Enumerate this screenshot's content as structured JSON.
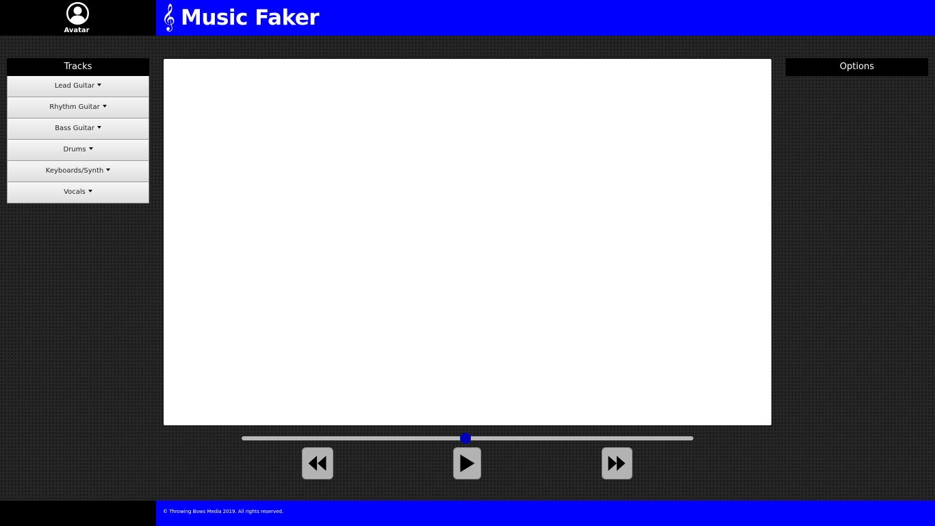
{
  "header": {
    "avatar_label": "Avatar",
    "avatar_icon": "user-circle-icon",
    "clef_icon": "treble-clef-icon",
    "clef_glyph": "𝄞",
    "title": "Music Faker"
  },
  "tracks": {
    "heading": "Tracks",
    "items": [
      {
        "label": "Lead Guitar"
      },
      {
        "label": "Rhythm Guitar"
      },
      {
        "label": "Bass Guitar"
      },
      {
        "label": "Drums"
      },
      {
        "label": "Keyboards/Synth"
      },
      {
        "label": "Vocals"
      }
    ]
  },
  "options": {
    "heading": "Options"
  },
  "player": {
    "position": 0.495,
    "rewind_icon": "rewind-icon",
    "play_icon": "play-icon",
    "forward_icon": "fast-forward-icon"
  },
  "footer": {
    "copyright": "© Throwing Bows Media 2019. All rights reserved."
  },
  "colors": {
    "brand_blue": "#0000ff",
    "thumb_blue": "#0000bb",
    "header_black": "#000000",
    "page_background": "#262626"
  }
}
